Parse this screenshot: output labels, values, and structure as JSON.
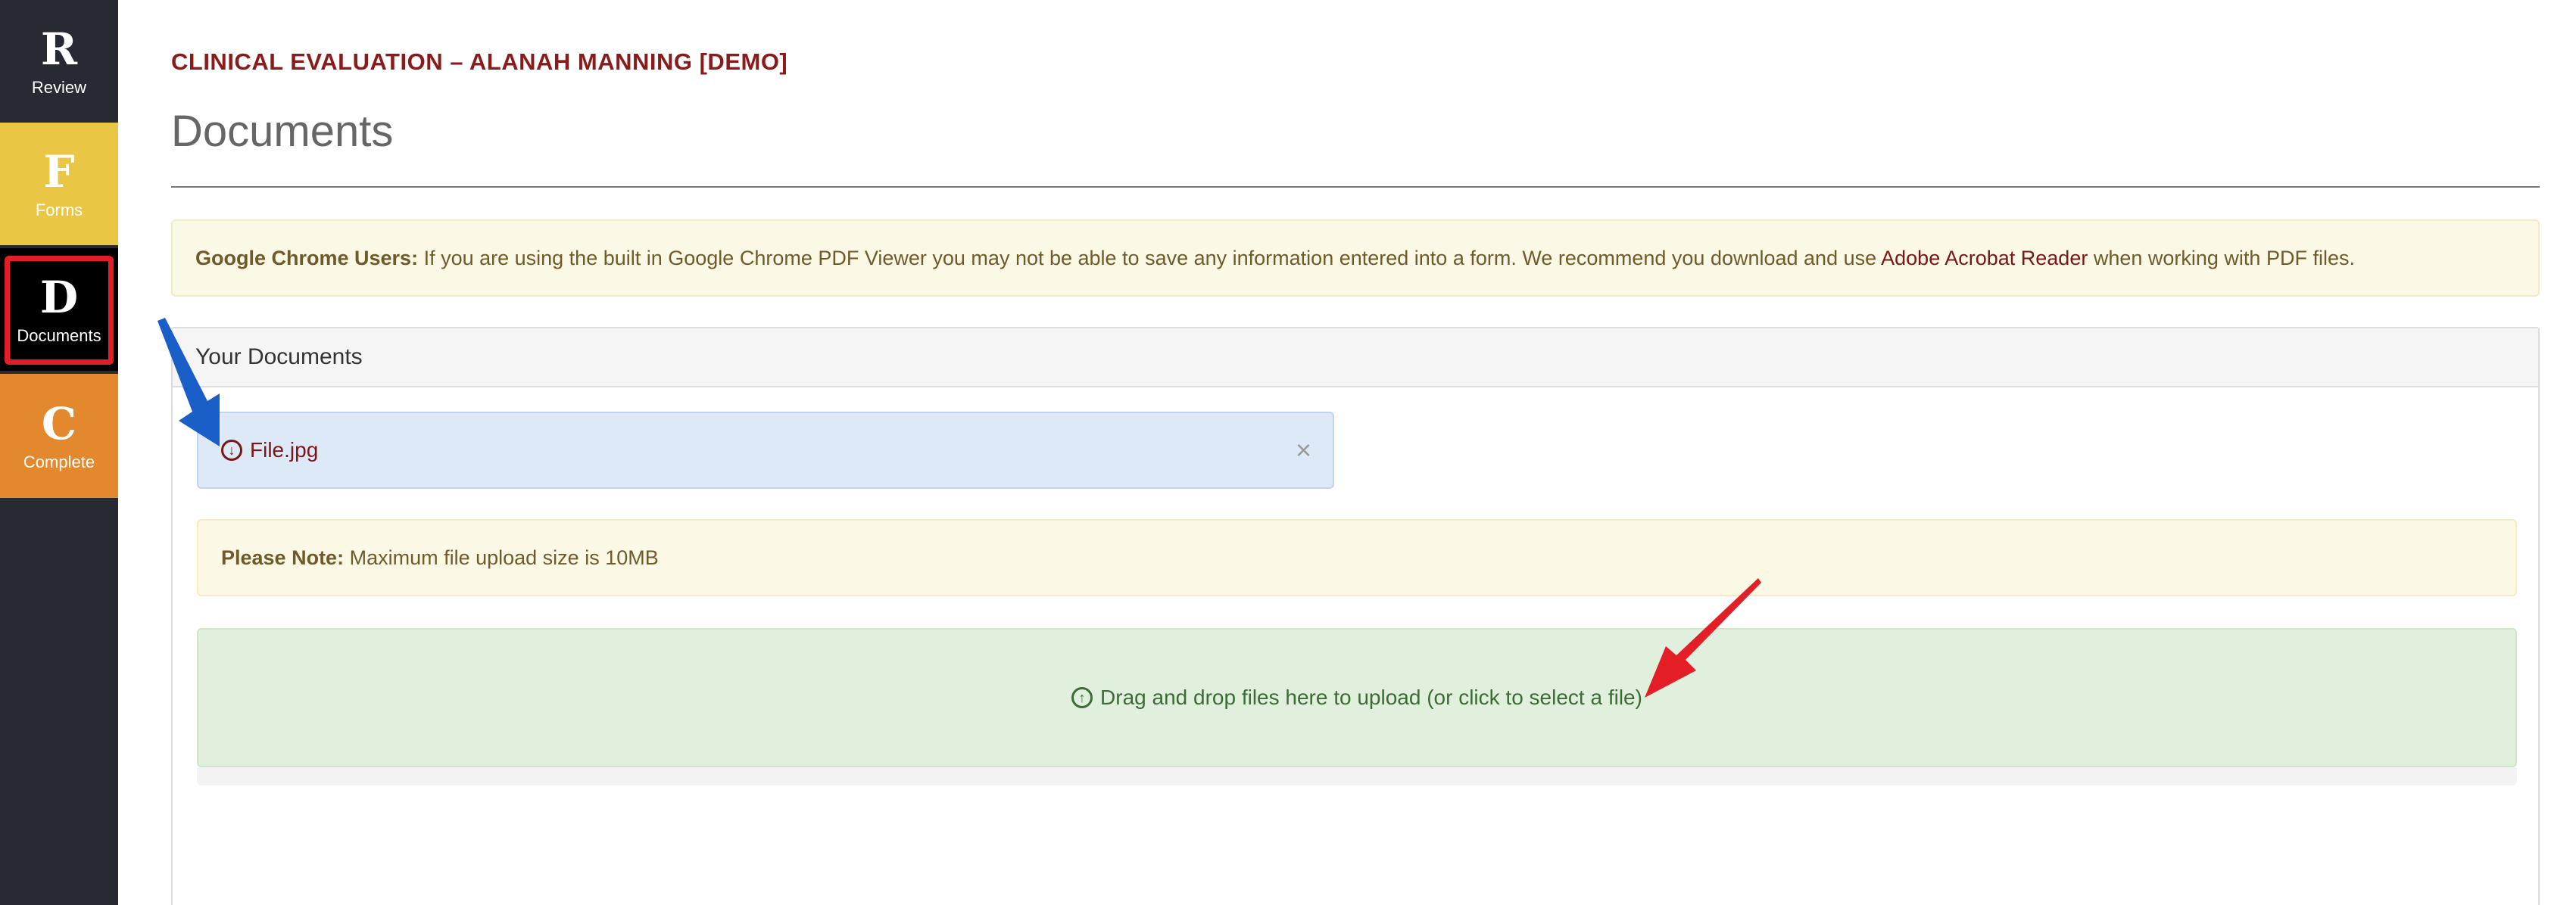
{
  "sidebar": {
    "items": [
      {
        "letter": "R",
        "label": "Review"
      },
      {
        "letter": "F",
        "label": "Forms"
      },
      {
        "letter": "D",
        "label": "Documents"
      },
      {
        "letter": "C",
        "label": "Complete"
      }
    ]
  },
  "header": {
    "subtitle": "CLINICAL EVALUATION – ALANAH MANNING [DEMO]",
    "title": "Documents"
  },
  "chrome_warning": {
    "bold": "Google Chrome Users:",
    "text_before": " If you are using the built in Google Chrome PDF Viewer you may not be able to save any information entered into a form. We recommend you download and use ",
    "link": "Adobe Acrobat Reader",
    "text_after": " when working with PDF files."
  },
  "documents_panel": {
    "heading": "Your Documents",
    "files": [
      {
        "name": "File.jpg",
        "close": "×"
      }
    ],
    "note_bold": "Please Note:",
    "note_text": " Maximum file upload size is 10MB",
    "dropzone_text": "Drag and drop files here to upload (or click to select a file)"
  },
  "colors": {
    "sidebar_bg": "#272a33",
    "forms_bg": "#e9c745",
    "complete_bg": "#e4882d",
    "active_highlight": "#e41e26",
    "brand_red": "#8b1a1a",
    "arrow_blue": "#1a5fc7",
    "arrow_red": "#e41e26"
  }
}
